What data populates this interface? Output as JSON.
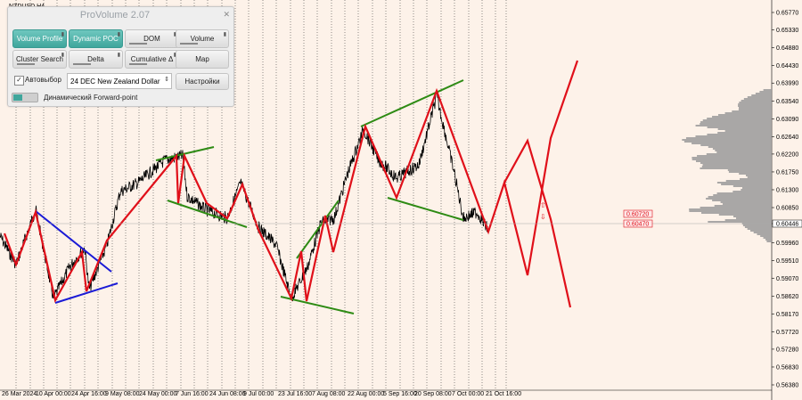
{
  "symbol": "NZDUSD,H4",
  "panel": {
    "title": "ProVolume 2.07",
    "close": "✕",
    "buttons": [
      {
        "label": "Volume Profile",
        "active": true
      },
      {
        "label": "Dynamic POC",
        "active": true
      },
      {
        "label": "DOM",
        "active": false
      },
      {
        "label": "Volume",
        "active": false
      },
      {
        "label": "Cluster Search",
        "active": false
      },
      {
        "label": "Delta",
        "active": false
      },
      {
        "label": "Cumulative Δ",
        "active": false
      },
      {
        "label": "Map",
        "active": false
      }
    ],
    "auto_label": "Автовыбор",
    "auto_checked": "✓",
    "instrument": "24 DEC New Zealand Dollar",
    "settings_label": "Настройки",
    "forward_label": "Динамический Forward-point"
  },
  "colors": {
    "accent": "#3fa69c",
    "price": "#000000",
    "red_zigzag": "#e0101a",
    "green_lines": "#2e8b14",
    "blue_lines": "#1a1ad6",
    "profile": "#9a9a9a",
    "background": "#fdf2e9"
  },
  "price_axis": [
    "0.65770",
    "0.65330",
    "0.64880",
    "0.64430",
    "0.63990",
    "0.63540",
    "0.63090",
    "0.62640",
    "0.62200",
    "0.61750",
    "0.61300",
    "0.60850",
    "0.60446",
    "0.59960",
    "0.59510",
    "0.59070",
    "0.58620",
    "0.58170",
    "0.57720",
    "0.57280",
    "0.56830",
    "0.56380"
  ],
  "time_axis": [
    "26 Mar 2024",
    "10 Apr 00:00",
    "24 Apr 16:00",
    "9 May 08:00",
    "24 May 00:00",
    "7 Jun 16:00",
    "24 Jun 08:00",
    "9 Jul 00:00",
    "23 Jul 16:00",
    "7 Aug 08:00",
    "22 Aug 00:00",
    "5 Sep 16:00",
    "20 Sep 08:00",
    "7 Oct 00:00",
    "21 Oct 16:00"
  ],
  "price_labels": {
    "upper": "0.60720",
    "lower": "0.60470"
  },
  "current_price": "0.60446"
}
